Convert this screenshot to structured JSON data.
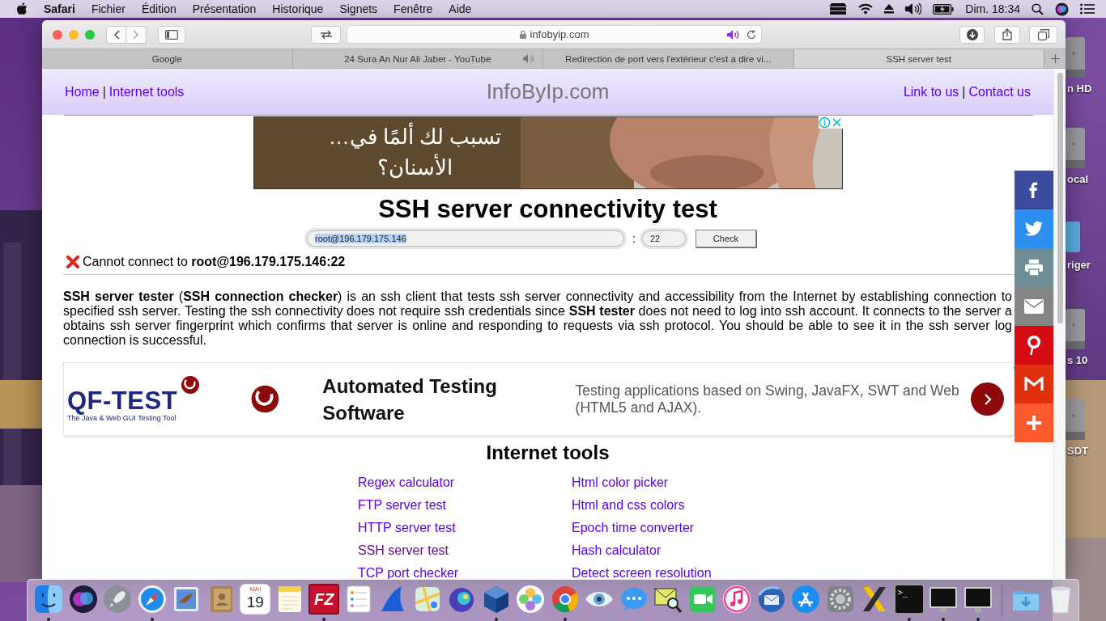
{
  "menu_bar": {
    "app": "Safari",
    "items": [
      "Fichier",
      "Édition",
      "Présentation",
      "Historique",
      "Signets",
      "Fenêtre",
      "Aide"
    ],
    "clock": "Dim. 18:34"
  },
  "desktop_icons": [
    {
      "kind": "drive",
      "label": "n HD"
    },
    {
      "kind": "drive",
      "label": "ocal"
    },
    {
      "kind": "folder",
      "label": "riger"
    },
    {
      "kind": "drive",
      "label": "s 10"
    },
    {
      "kind": "drive",
      "label": "SDT"
    }
  ],
  "browser": {
    "address": "infobyip.com",
    "tabs": [
      {
        "title": "Google",
        "selected": false,
        "audio": false
      },
      {
        "title": "24 Sura An Nur Ali Jaber - YouTube",
        "selected": false,
        "audio": true
      },
      {
        "title": "Redirection de port vers l'extérieur c'est a dire vi...",
        "selected": false,
        "audio": false
      },
      {
        "title": "SSH server test",
        "selected": true,
        "audio": false
      }
    ]
  },
  "page": {
    "header": {
      "left": [
        {
          "kind": "link",
          "text": "Home"
        },
        {
          "kind": "separator",
          "text": "|"
        },
        {
          "kind": "link",
          "text": "Internet tools"
        }
      ],
      "site_title": "InfoByIp.com",
      "right": [
        {
          "kind": "link",
          "text": "Link to us"
        },
        {
          "kind": "separator",
          "text": "|"
        },
        {
          "kind": "link",
          "text": "Contact us"
        }
      ]
    },
    "top_ad": {
      "kind": "picture",
      "text": "…تسبب لك ألمًا في الأسنان؟"
    },
    "heading": "SSH server connectivity test",
    "form": {
      "host": "root@196.179.175.146",
      "host_selected": true,
      "separator": ":",
      "port": "22",
      "button": "Check"
    },
    "result": {
      "kind": "error",
      "text": "Cannot connect to **root@196.179.175.146:22**"
    },
    "description_lines": [
      "**SSH server tester** (**SSH connection checker**) is an ssh client that tests ssh server connectivity and accessibility from the Internet by establishing connection to",
      "specified ssh server. Testing the ssh connectivity does not require ssh credentials since **SSH tester** does not need to log into ssh account. It connects to the server a",
      "obtains ssh server fingerprint which confirms that server is online and responding to requests via ssh protocol. You should be able to see it in the ssh server log",
      "connection is successful."
    ],
    "banner_ad": {
      "logo": "QF-TEST",
      "logo_tagline": "The Java & Web GUI Testing Tool",
      "title": "Automated Testing Software",
      "text": "Testing applications based on Swing, JavaFX, SWT and Web (HTML5 and AJAX)."
    },
    "tools": {
      "title": "Internet tools",
      "columns": [
        [
          {
            "label": "Regex calculator",
            "visited": false
          },
          {
            "label": "FTP server test",
            "visited": false
          },
          {
            "label": "HTTP server test",
            "visited": false
          },
          {
            "label": "SSH server test",
            "visited": true
          },
          {
            "label": "TCP port checker",
            "visited": false
          }
        ],
        [
          {
            "label": "Html color picker",
            "visited": false
          },
          {
            "label": "Html and css colors",
            "visited": false
          },
          {
            "label": "Epoch time converter",
            "visited": false
          },
          {
            "label": "Hash calculator",
            "visited": false
          },
          {
            "label": "Detect screen resolution",
            "visited": false
          }
        ]
      ]
    },
    "share_buttons": [
      {
        "kind": "facebook",
        "color": "#3b4ba0"
      },
      {
        "kind": "twitter",
        "color": "#2d8ff0"
      },
      {
        "kind": "print",
        "color": "#6e8d94"
      },
      {
        "kind": "email",
        "color": "#858585"
      },
      {
        "kind": "pinterest",
        "color": "#d40b12"
      },
      {
        "kind": "gmail",
        "color": "#e0300f"
      },
      {
        "kind": "more",
        "color": "#ff5a2e"
      }
    ]
  },
  "dock": {
    "apps": [
      {
        "kind": "finder",
        "running": true
      },
      {
        "kind": "siri",
        "running": false
      },
      {
        "kind": "launchpad",
        "running": false
      },
      {
        "kind": "safari",
        "running": true
      },
      {
        "kind": "preview",
        "running": false
      },
      {
        "kind": "contacts",
        "running": false
      },
      {
        "kind": "calendar",
        "running": false,
        "month": "MAI",
        "day": "19"
      },
      {
        "kind": "notes",
        "running": false
      },
      {
        "kind": "filezilla",
        "running": true,
        "label": "FZ"
      },
      {
        "kind": "reminders",
        "running": false
      },
      {
        "kind": "fin",
        "running": false
      },
      {
        "kind": "maps",
        "running": false
      },
      {
        "kind": "chameleon",
        "running": false
      },
      {
        "kind": "cube",
        "running": true
      },
      {
        "kind": "photos",
        "running": false
      },
      {
        "kind": "chrome",
        "running": true
      },
      {
        "kind": "eye",
        "running": false
      },
      {
        "kind": "messages",
        "running": false
      },
      {
        "kind": "mailsearch",
        "running": false
      },
      {
        "kind": "facetime",
        "running": false
      },
      {
        "kind": "music",
        "running": false
      },
      {
        "kind": "thunderbird",
        "running": false
      },
      {
        "kind": "appstore",
        "running": false
      },
      {
        "kind": "preferences",
        "running": false
      },
      {
        "kind": "xmark",
        "running": false
      },
      {
        "kind": "terminal",
        "running": true,
        "label": ">_"
      },
      {
        "kind": "screen",
        "running": true
      },
      {
        "kind": "screen",
        "running": true
      }
    ],
    "stacks": [
      {
        "kind": "downloads"
      },
      {
        "kind": "trash"
      }
    ]
  }
}
